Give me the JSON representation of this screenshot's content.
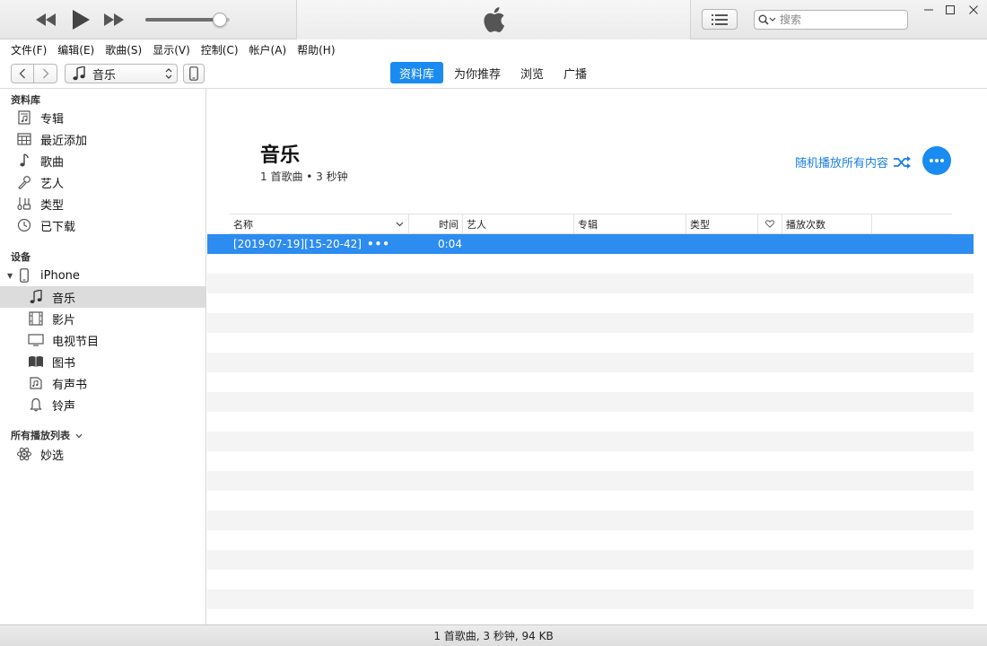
{
  "player": {
    "volume_percent": 88,
    "search_placeholder": "搜索"
  },
  "menu": [
    "文件(F)",
    "编辑(E)",
    "歌曲(S)",
    "显示(V)",
    "控制(C)",
    "帐户(A)",
    "帮助(H)"
  ],
  "nav": {
    "media_selector": "音乐",
    "tabs": [
      {
        "label": "资料库",
        "active": true
      },
      {
        "label": "为你推荐",
        "active": false
      },
      {
        "label": "浏览",
        "active": false
      },
      {
        "label": "广播",
        "active": false
      }
    ]
  },
  "sidebar": {
    "library_header": "资料库",
    "library_items": [
      {
        "label": "专辑",
        "icon": "album-icon"
      },
      {
        "label": "最近添加",
        "icon": "calendar-grid-icon"
      },
      {
        "label": "歌曲",
        "icon": "music-note-icon"
      },
      {
        "label": "艺人",
        "icon": "microphone-icon"
      },
      {
        "label": "类型",
        "icon": "genre-icon"
      },
      {
        "label": "已下载",
        "icon": "download-clock-icon"
      }
    ],
    "devices_header": "设备",
    "device_name": "iPhone",
    "device_items": [
      {
        "label": "音乐",
        "icon": "music-note-icon",
        "selected": true
      },
      {
        "label": "影片",
        "icon": "film-icon",
        "selected": false
      },
      {
        "label": "电视节目",
        "icon": "tv-icon",
        "selected": false
      },
      {
        "label": "图书",
        "icon": "book-icon",
        "selected": false
      },
      {
        "label": "有声书",
        "icon": "audiobook-icon",
        "selected": false
      },
      {
        "label": "铃声",
        "icon": "bell-icon",
        "selected": false
      }
    ],
    "playlists_header": "所有播放列表",
    "playlist_items": [
      {
        "label": "妙选",
        "icon": "genius-atom-icon"
      }
    ]
  },
  "main": {
    "title": "音乐",
    "subtitle": "1 首歌曲 • 3 秒钟",
    "shuffle_label": "随机播放所有内容",
    "columns": {
      "name": "名称",
      "time": "时间",
      "artist": "艺人",
      "album": "专辑",
      "genre": "类型",
      "plays": "播放次数"
    },
    "songs": [
      {
        "name": "[2019-07-19][15-20-42]",
        "time": "0:04",
        "artist": "",
        "album": "",
        "genre": "",
        "plays": ""
      }
    ]
  },
  "status": {
    "summary": "1 首歌曲, 3 秒钟, 94 KB"
  }
}
